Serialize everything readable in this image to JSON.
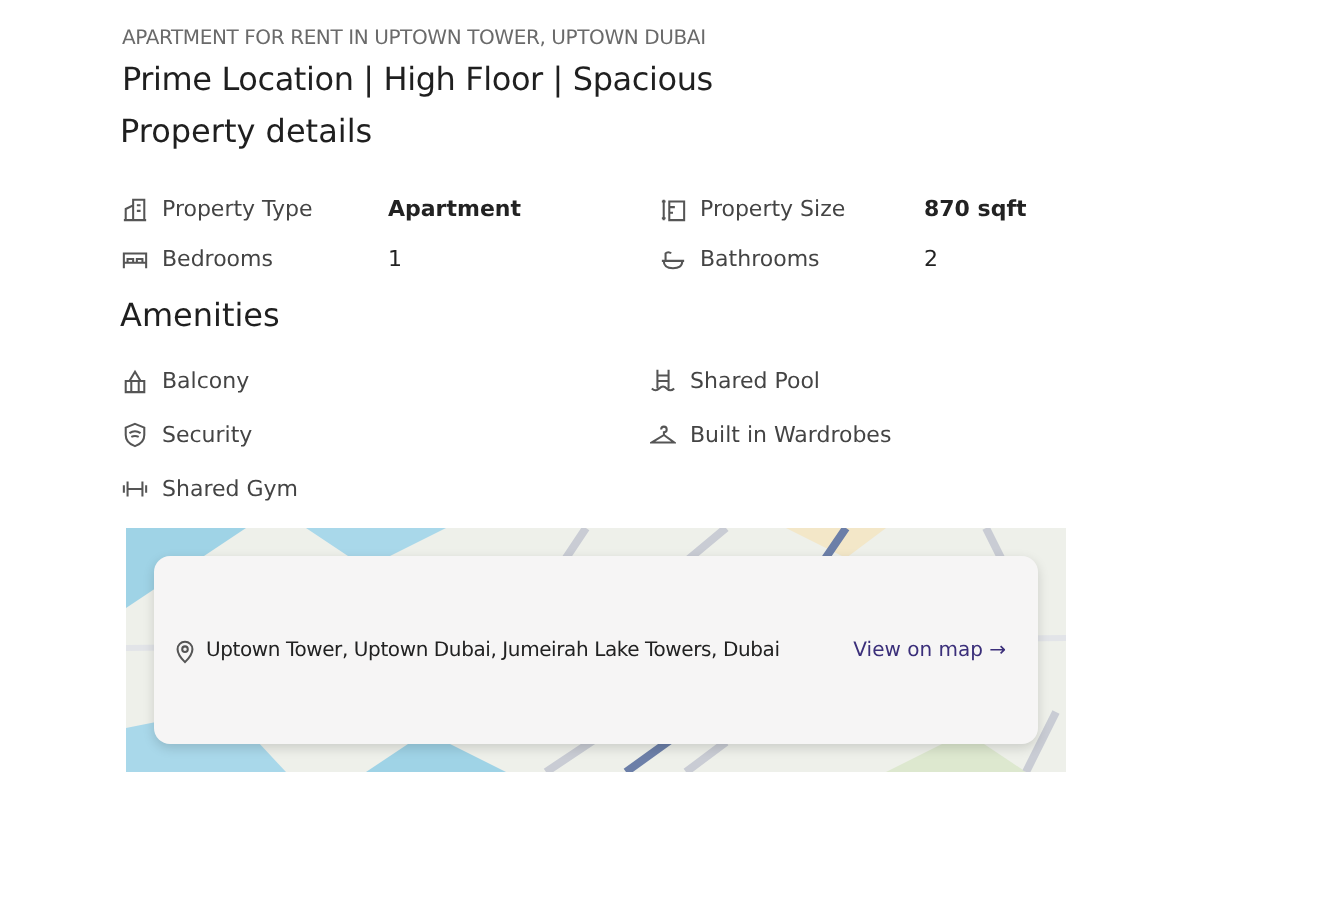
{
  "listing": {
    "category": "APARTMENT FOR RENT IN UPTOWN TOWER, UPTOWN DUBAI",
    "title": "Prime Location | High Floor | Spacious"
  },
  "property_details": {
    "heading": "Property details",
    "items": [
      {
        "label": "Property Type",
        "value": "Apartment"
      },
      {
        "label": "Property Size",
        "value": "870 sqft"
      },
      {
        "label": "Bedrooms",
        "value": "1"
      },
      {
        "label": "Bathrooms",
        "value": "2"
      }
    ]
  },
  "amenities": {
    "heading": "Amenities",
    "items": [
      "Balcony",
      "Shared Pool",
      "Security",
      "Built in Wardrobes",
      "Shared Gym"
    ]
  },
  "location": {
    "address": "Uptown Tower, Uptown Dubai, Jumeirah Lake Towers, Dubai",
    "link": "View on map →"
  }
}
